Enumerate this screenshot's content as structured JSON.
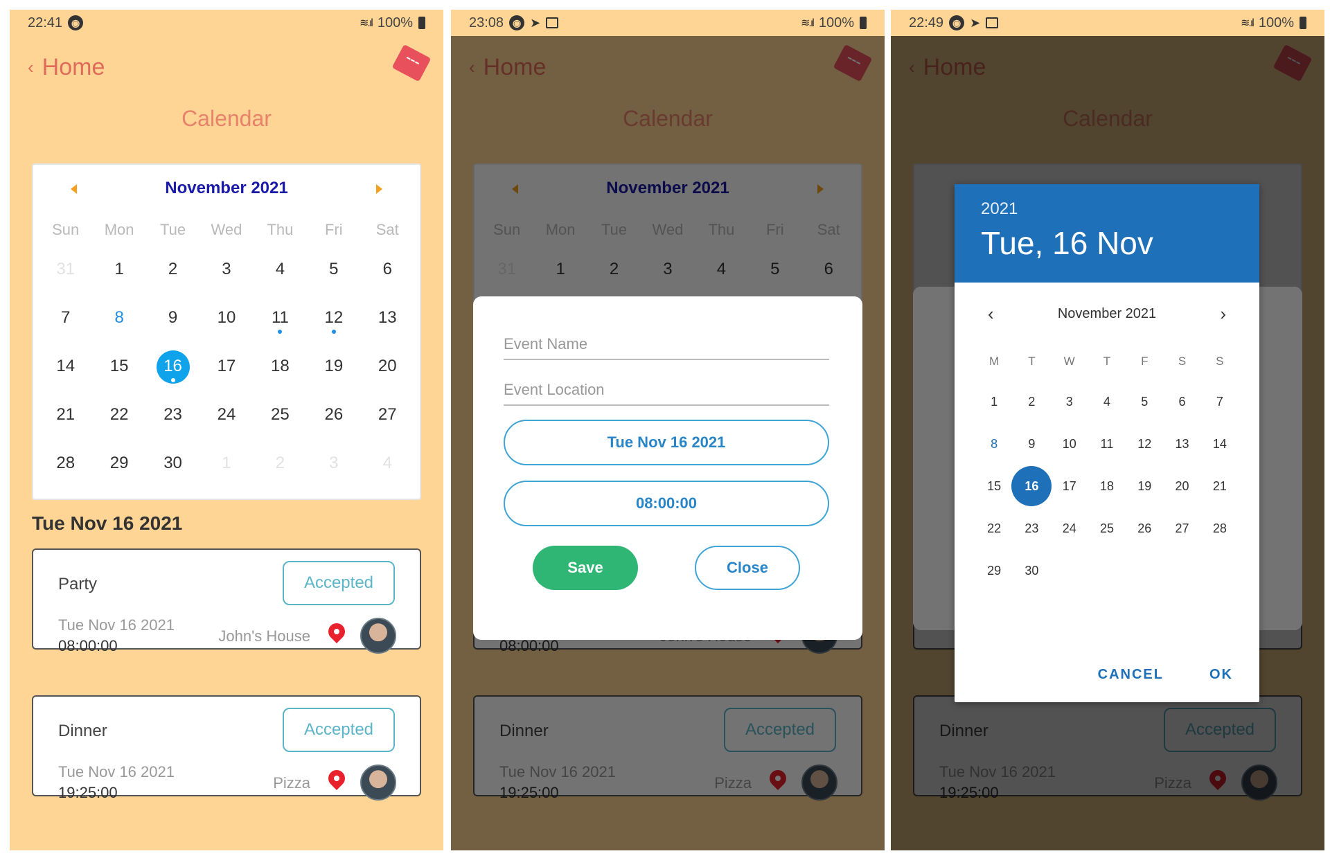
{
  "colors": {
    "background": "#ffd595",
    "accent_blue": "#1e8ee6",
    "picker_blue": "#1e70b8",
    "save_green": "#2fb674",
    "title_coral": "#e8826a"
  },
  "screen1": {
    "status": {
      "time": "22:41",
      "battery": "100%"
    },
    "nav": {
      "back_label": "Home",
      "logo_icon": "ticket-icon"
    },
    "page_title": "Calendar",
    "calendar": {
      "month_label": "November 2021",
      "weekdays": [
        "Sun",
        "Mon",
        "Tue",
        "Wed",
        "Thu",
        "Fri",
        "Sat"
      ],
      "weeks": [
        [
          "31",
          "1",
          "2",
          "3",
          "4",
          "5",
          "6"
        ],
        [
          "7",
          "8",
          "9",
          "10",
          "11",
          "12",
          "13"
        ],
        [
          "14",
          "15",
          "16",
          "17",
          "18",
          "19",
          "20"
        ],
        [
          "21",
          "22",
          "23",
          "24",
          "25",
          "26",
          "27"
        ],
        [
          "28",
          "29",
          "30",
          "1",
          "2",
          "3",
          "4"
        ]
      ],
      "selected": "16",
      "today": "8",
      "event_days": [
        "11",
        "12",
        "16"
      ]
    },
    "selected_date_heading": "Tue Nov 16 2021",
    "events": [
      {
        "name": "Party",
        "status": "Accepted",
        "date": "Tue Nov 16 2021",
        "time": "08:00:00",
        "location": "John's House"
      },
      {
        "name": "Dinner",
        "status": "Accepted",
        "date": "Tue Nov 16 2021",
        "time": "19:25:00",
        "location": "Pizza"
      }
    ]
  },
  "screen2": {
    "status": {
      "time": "23:08",
      "battery": "100%"
    },
    "modal": {
      "event_name_placeholder": "Event Name",
      "event_location_placeholder": "Event Location",
      "date_button": "Tue Nov 16 2021",
      "time_button": "08:00:00",
      "save_label": "Save",
      "close_label": "Close"
    }
  },
  "screen3": {
    "status": {
      "time": "22:49",
      "battery": "100%"
    },
    "picker": {
      "year": "2021",
      "selected_label": "Tue, 16 Nov",
      "month_label": "November 2021",
      "weekdays": [
        "M",
        "T",
        "W",
        "T",
        "F",
        "S",
        "S"
      ],
      "weeks": [
        [
          "1",
          "2",
          "3",
          "4",
          "5",
          "6",
          "7"
        ],
        [
          "8",
          "9",
          "10",
          "11",
          "12",
          "13",
          "14"
        ],
        [
          "15",
          "16",
          "17",
          "18",
          "19",
          "20",
          "21"
        ],
        [
          "22",
          "23",
          "24",
          "25",
          "26",
          "27",
          "28"
        ],
        [
          "29",
          "30",
          "",
          "",
          "",
          "",
          ""
        ]
      ],
      "selected": "16",
      "today": "8",
      "cancel_label": "CANCEL",
      "ok_label": "OK"
    }
  }
}
